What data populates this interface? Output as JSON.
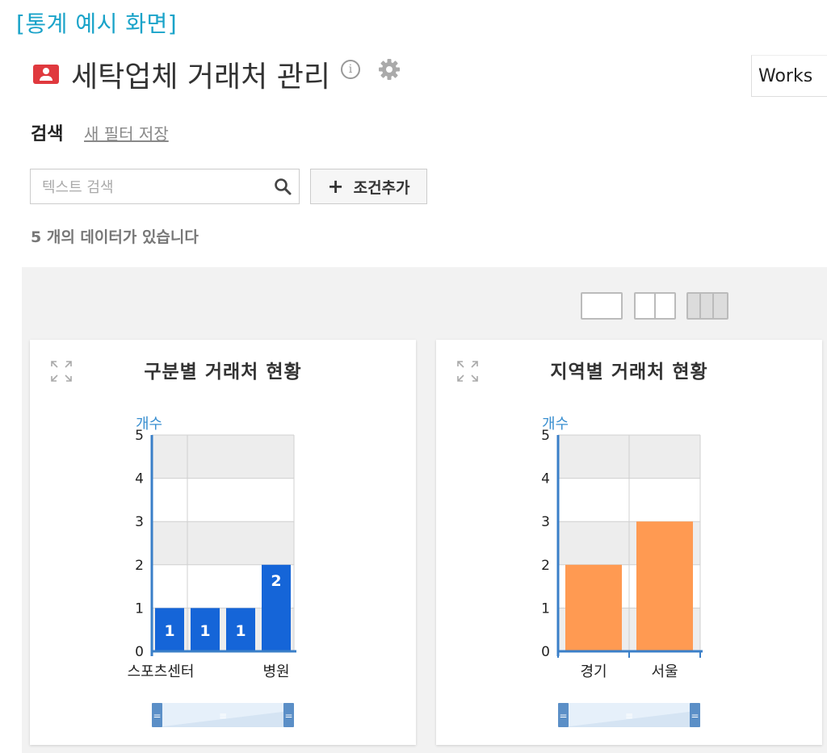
{
  "caption": "[통계 예시 화면]",
  "header": {
    "title": "세탁업체 거래처 관리",
    "works_label": "Works"
  },
  "search": {
    "label": "검색",
    "save_filter": "새 필터 저장",
    "placeholder": "텍스트 검색",
    "add_condition": "조건추가"
  },
  "result_count": "5 개의 데이터가 있습니다",
  "icons": {
    "app": "contact-card-icon",
    "info": "info-icon",
    "settings": "gear-icon",
    "search": "search-icon",
    "add": "plus-icon",
    "expand": "expand-icon"
  },
  "charts": {
    "left": {
      "title": "구분별 거래처 현황"
    },
    "right": {
      "title": "지역별 거래처 현황"
    }
  },
  "chart_data": [
    {
      "type": "bar",
      "title": "구분별 거래처 현황",
      "ylabel": "개수",
      "ylim": [
        0,
        5
      ],
      "yticks": [
        0,
        1,
        2,
        3,
        4,
        5
      ],
      "categories": [
        "스포츠센터",
        "",
        "",
        "병원"
      ],
      "x_tick_labels": [
        "스포츠센터",
        "병원"
      ],
      "values": [
        1,
        1,
        1,
        2
      ],
      "data_labels": true,
      "bar_color": "#1565d8",
      "grid": true
    },
    {
      "type": "bar",
      "title": "지역별 거래처 현황",
      "ylabel": "개수",
      "ylim": [
        0,
        5
      ],
      "yticks": [
        0,
        1,
        2,
        3,
        4,
        5
      ],
      "categories": [
        "경기",
        "서울"
      ],
      "values": [
        2,
        3
      ],
      "data_labels": false,
      "bar_color": "#ff9a52",
      "grid": true
    }
  ]
}
